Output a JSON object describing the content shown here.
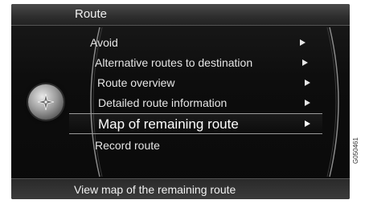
{
  "header": {
    "title": "Route"
  },
  "menu": {
    "items": [
      {
        "label": "Avoid",
        "has_arrow": true,
        "selected": false
      },
      {
        "label": "Alternative routes to destination",
        "has_arrow": true,
        "selected": false
      },
      {
        "label": "Route overview",
        "has_arrow": true,
        "selected": false
      },
      {
        "label": "Detailed route information",
        "has_arrow": true,
        "selected": false
      },
      {
        "label": "Map of remaining route",
        "has_arrow": true,
        "selected": true
      },
      {
        "label": "Record route",
        "has_arrow": false,
        "selected": false
      }
    ]
  },
  "knob": {
    "icon": "compass-icon"
  },
  "footer": {
    "description": "View map of the remaining route"
  },
  "watermark": {
    "code": "G050461"
  },
  "colors": {
    "background": "#0d0d0d",
    "text": "#e6e6e6",
    "header": "#3a3a3a",
    "selection_border": "#9a9a9a"
  }
}
